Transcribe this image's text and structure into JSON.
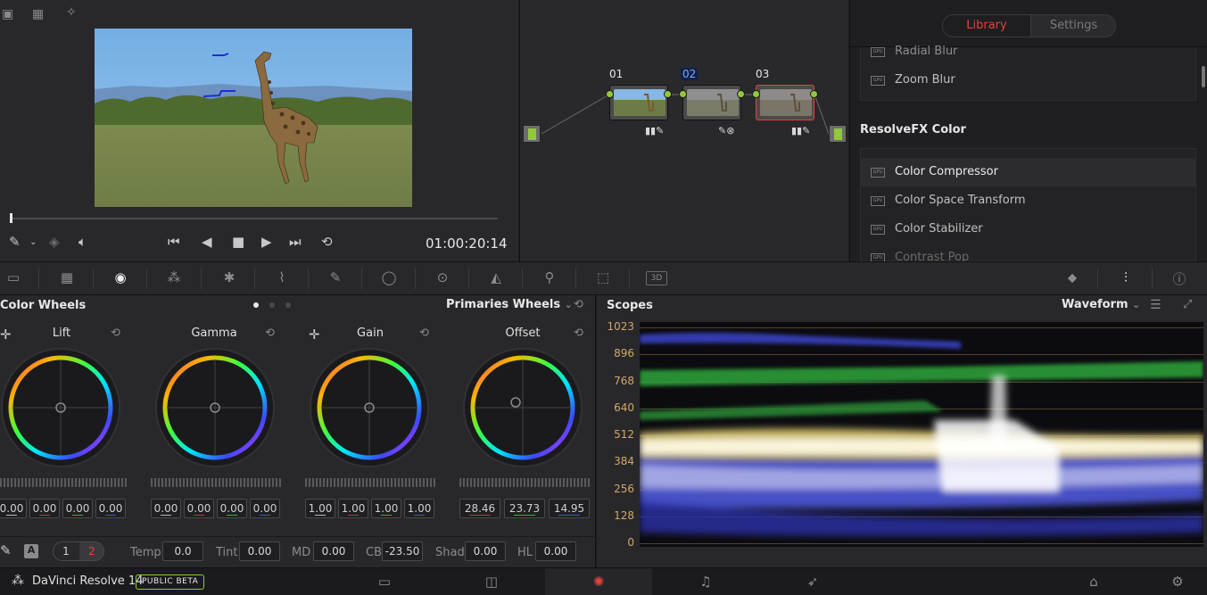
{
  "viewer": {
    "timecode": "01:00:20:14",
    "playhead_fraction": 0.0
  },
  "nodes": [
    {
      "label": "01",
      "selected": false
    },
    {
      "label": "02",
      "selected": false
    },
    {
      "label": "03",
      "selected": true
    }
  ],
  "library": {
    "tabs": [
      {
        "label": "Library",
        "active": true
      },
      {
        "label": "Settings",
        "active": false
      }
    ],
    "items_top": [
      "Radial Blur",
      "Zoom Blur"
    ],
    "category": "ResolveFX Color",
    "items": [
      {
        "label": "Color Compressor",
        "selected": true
      },
      {
        "label": "Color Space Transform",
        "selected": false
      },
      {
        "label": "Color Stabilizer",
        "selected": false
      },
      {
        "label": "Contrast Pop",
        "selected": false
      }
    ],
    "gpu_badge": "GPU"
  },
  "tools": {
    "threed_label": "3D"
  },
  "color_wheels": {
    "title": "Color Wheels",
    "mode": "Primaries Wheels",
    "wheels": [
      {
        "name": "Lift",
        "values": [
          "0.00",
          "0.00",
          "0.00",
          "0.00"
        ]
      },
      {
        "name": "Gamma",
        "values": [
          "0.00",
          "0.00",
          "0.00",
          "0.00"
        ]
      },
      {
        "name": "Gain",
        "values": [
          "1.00",
          "1.00",
          "1.00",
          "1.00"
        ]
      },
      {
        "name": "Offset",
        "values": [
          "28.46",
          "23.73",
          "14.95"
        ]
      }
    ],
    "auto_label": "A",
    "page_buttons": [
      "1",
      "2"
    ],
    "params": [
      {
        "label": "Temp",
        "value": "0.0"
      },
      {
        "label": "Tint",
        "value": "0.00"
      },
      {
        "label": "MD",
        "value": "0.00"
      },
      {
        "label": "CB",
        "value": "-23.50"
      },
      {
        "label": "Shad",
        "value": "0.00"
      },
      {
        "label": "HL",
        "value": "0.00"
      }
    ]
  },
  "scopes": {
    "title": "Scopes",
    "mode": "Waveform",
    "ticks": [
      "1023",
      "896",
      "768",
      "640",
      "512",
      "384",
      "256",
      "128",
      "0"
    ]
  },
  "status": {
    "app_name": "DaVinci Resolve 14",
    "badge": "PUBLIC BETA"
  },
  "colors": {
    "accent_red": "#e4423b",
    "node_green": "#93c83a",
    "panel": "#28282b"
  }
}
